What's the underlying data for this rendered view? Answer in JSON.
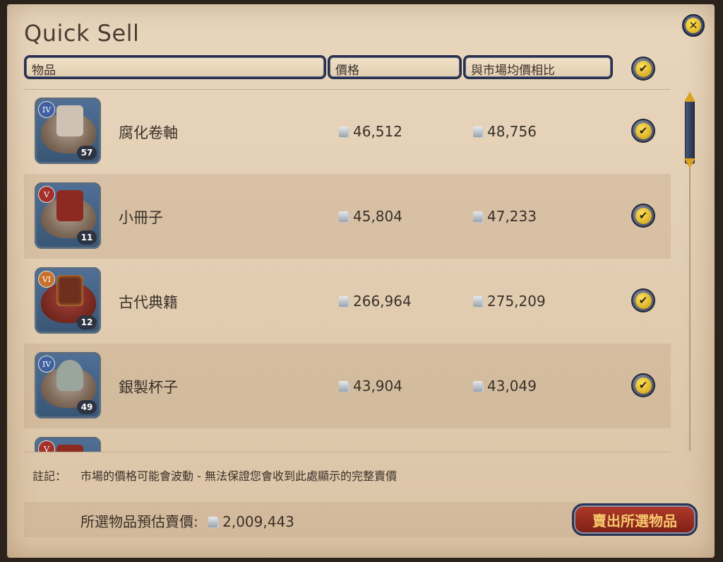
{
  "window": {
    "title": "Quick Sell",
    "close_label": "✕"
  },
  "header": {
    "col_item": "物品",
    "col_price": "價格",
    "col_market": "與市場均價相比",
    "select_all_check": "✔"
  },
  "items": [
    {
      "tier": "IV",
      "tier_color": "#3f5fa0",
      "name": "腐化卷軸",
      "qty": "57",
      "price": "46,512",
      "market": "48,756",
      "check": "✔",
      "art_color": "#cfc2b5"
    },
    {
      "tier": "V",
      "tier_color": "#a3302a",
      "name": "小冊子",
      "qty": "11",
      "price": "45,804",
      "market": "47,233",
      "check": "✔",
      "art_color": "#8c2a22"
    },
    {
      "tier": "VI",
      "tier_color": "#c8702a",
      "name": "古代典籍",
      "qty": "12",
      "price": "266,964",
      "market": "275,209",
      "check": "✔",
      "art_color": "#6e2f1c"
    },
    {
      "tier": "IV",
      "tier_color": "#3f5fa0",
      "name": "銀製杯子",
      "qty": "49",
      "price": "43,904",
      "market": "43,049",
      "check": "✔",
      "art_color": "#9aa59c"
    },
    {
      "tier": "V",
      "tier_color": "#a3302a",
      "name": "",
      "qty": "",
      "price": "",
      "market": "",
      "check": "",
      "art_color": "#8c2a22"
    }
  ],
  "footer": {
    "note_label": "註記：",
    "note_text": "市場的價格可能會波動 - 無法保證您會收到此處顯示的完整賣價",
    "total_label": "所選物品預估賣價:",
    "total_value": "2,009,443",
    "sell_button": "賣出所選物品"
  },
  "colors": {
    "panel_bg": "#e1ccb0",
    "accent_gold": "#d9a021",
    "sell_red": "#9a2c20",
    "frame_navy": "#28304d"
  },
  "icons": [
    "close-icon",
    "check-icon",
    "silver-coin-icon",
    "scroll-up-arrow-icon",
    "scroll-down-arrow-icon"
  ]
}
